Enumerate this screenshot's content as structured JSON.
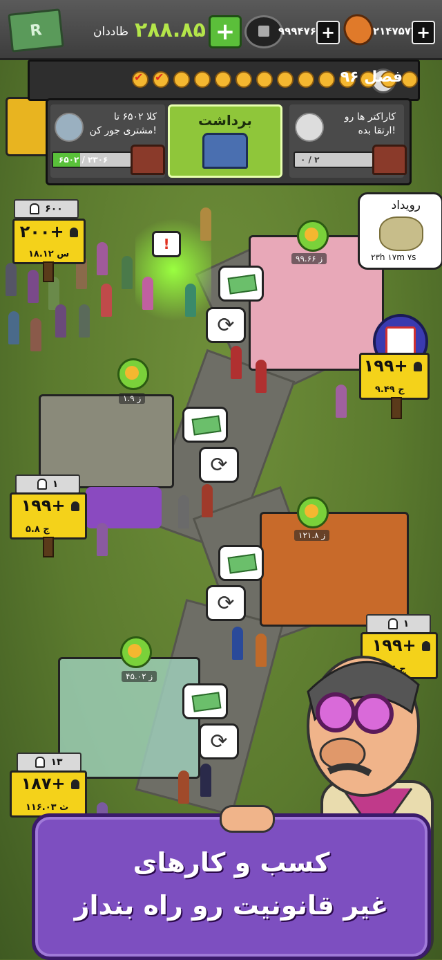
{
  "topbar": {
    "money_label": "ظاددان",
    "money_value": "۲۸۸.۸۵",
    "money_icon_letter": "R",
    "coin_value": "۹۹۹۴۷۶۷۰",
    "candy_value": "۲۱۴۷۵۷۷"
  },
  "season": {
    "label": "فصل ۹۶",
    "completed": 2,
    "total": 14
  },
  "quests": {
    "left": {
      "text_line1": "کلا ۶۵۰۲ تا",
      "text_line2": "مشتری جور کن!",
      "progress_text": "۶۵۰۲ / ۲۳۰۶",
      "progress": 0.35
    },
    "center": {
      "label": "برداشت"
    },
    "right": {
      "text_line1": "کاراکتر ها رو",
      "text_line2": "ارتقا بده!",
      "progress_text": "۰ / ۲",
      "progress": 0.0
    }
  },
  "event": {
    "title": "رویداد",
    "timer": "۲۳h ۱۷m ۷s"
  },
  "signs": [
    {
      "id": "beauty",
      "capacity": "۶۰۰",
      "bonus": "۲۰۰+",
      "income": "۱۸.۱۲ س"
    },
    {
      "id": "salon",
      "capacity": "",
      "bonus": "۱۹۹+",
      "income": "۹.۴۹ ج"
    },
    {
      "id": "honey",
      "capacity": "۱",
      "bonus": "۱۹۹+",
      "income": "۵.۸ ج"
    },
    {
      "id": "casino",
      "capacity": "۱",
      "bonus": "۱۹۹+",
      "income": "۱.۱۶ ج"
    },
    {
      "id": "greenhouse",
      "capacity": "۱۳",
      "bonus": "۱۸۷+",
      "income": "۱۱۶.۰۳ ث"
    }
  ],
  "income_labels": {
    "salon": "۹۹.۶۶ ز",
    "honey": "۱.۹ ز",
    "casino": "۱۲۱.۸ ز",
    "greenhouse": "۴۵.۰۲ ز"
  },
  "banner": {
    "line1": "کسب و کارهای",
    "line2": "غیر قانونیت رو راه بنداز"
  }
}
